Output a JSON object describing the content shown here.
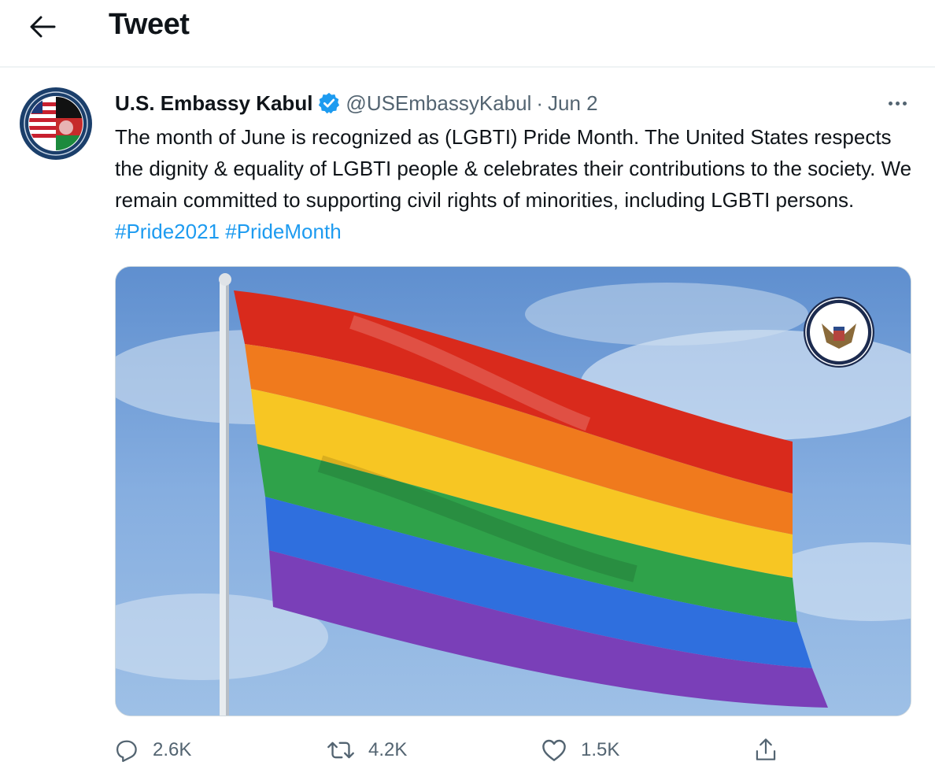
{
  "header": {
    "title": "Tweet",
    "back_icon": "arrow-left-icon"
  },
  "tweet": {
    "author": {
      "display_name": "U.S. Embassy Kabul",
      "verified": true,
      "handle": "@USEmbassyKabul"
    },
    "separator": "·",
    "date": "Jun 2",
    "text": "The month of June is recognized as (LGBTI) Pride Month. The United States respects the dignity & equality of LGBTI people & celebrates their contributions to the society. We remain committed to supporting civil rights of minorities, including LGBTI persons.",
    "hashtags": [
      "#Pride2021",
      "#PrideMonth"
    ],
    "media": {
      "description_icon": "rainbow-pride-flag-image"
    }
  },
  "actions": {
    "reply": {
      "icon": "reply-icon",
      "count": "2.6K"
    },
    "retweet": {
      "icon": "retweet-icon",
      "count": "4.2K"
    },
    "like": {
      "icon": "heart-icon",
      "count": "1.5K"
    },
    "share": {
      "icon": "share-icon"
    }
  },
  "colors": {
    "accent": "#1d9bf0",
    "text": "#0f1419",
    "muted": "#536471",
    "border": "#eff3f4"
  }
}
